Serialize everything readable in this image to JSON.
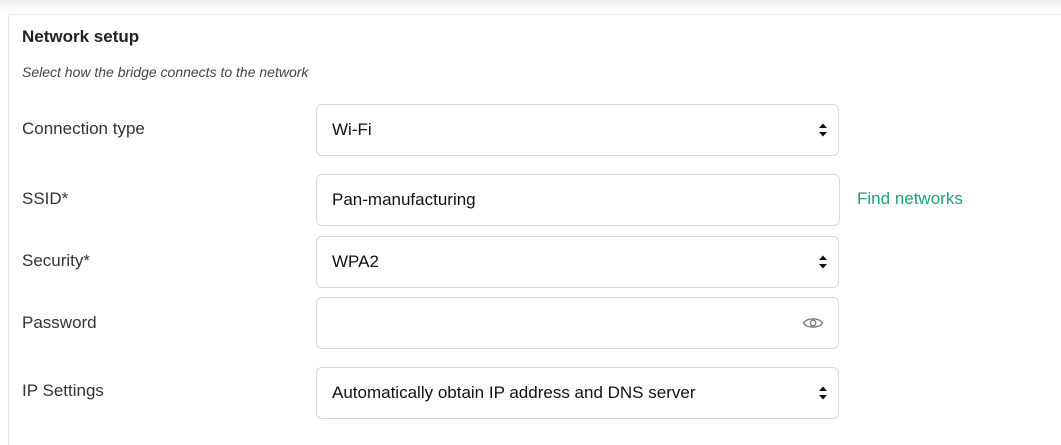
{
  "section": {
    "title": "Network setup",
    "subtitle": "Select how the bridge connects to the network"
  },
  "connection_type": {
    "label": "Connection type",
    "value": "Wi-Fi"
  },
  "ssid": {
    "label": "SSID*",
    "value": "Pan-manufacturing",
    "find_networks_label": "Find networks"
  },
  "security": {
    "label": "Security*",
    "value": "WPA2"
  },
  "password": {
    "label": "Password",
    "value": ""
  },
  "ip_settings": {
    "label": "IP Settings",
    "value": "Automatically obtain IP address and DNS server"
  },
  "colors": {
    "link": "#1fa27a",
    "border": "#d9d9d9"
  },
  "icons": {
    "select_arrow": "chevron-up-down-icon",
    "password_toggle": "eye-icon"
  }
}
